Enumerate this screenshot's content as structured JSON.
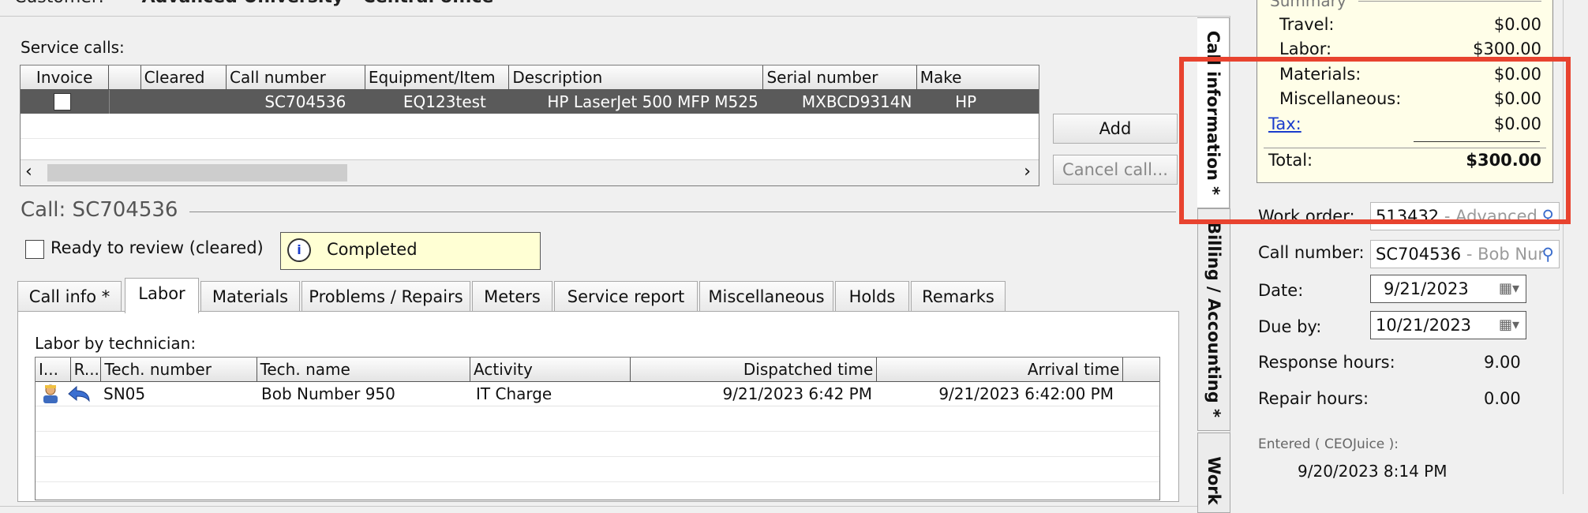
{
  "header": {
    "customer_label": "Customer:",
    "customer_value": "Advanced University - Central office"
  },
  "service_calls": {
    "label": "Service calls:",
    "columns": [
      "Invoice",
      "",
      "Cleared",
      "Call number",
      "Equipment/Item",
      "Description",
      "Serial number",
      "Make"
    ],
    "rows": [
      {
        "call_number": "SC704536",
        "equipment": "EQ123test",
        "description": "HP LaserJet 500 MFP M525",
        "serial": "MXBCD9314N",
        "make": "HP"
      }
    ],
    "add_button": "Add",
    "cancel_button": "Cancel call..."
  },
  "call": {
    "title": "Call: SC704536",
    "ready_label": "Ready to review (cleared)",
    "status": "Completed"
  },
  "tabs": [
    "Call info *",
    "Labor",
    "Materials",
    "Problems / Repairs",
    "Meters",
    "Service report",
    "Miscellaneous",
    "Holds",
    "Remarks"
  ],
  "labor": {
    "label": "Labor by technician:",
    "columns": [
      "I...",
      "R...",
      "Tech. number",
      "Tech. name",
      "Activity",
      "Dispatched time",
      "Arrival time"
    ],
    "rows": [
      {
        "tech_number": "SN05",
        "tech_name": "Bob Number 950",
        "activity": "IT Charge",
        "dispatched": "9/21/2023 6:42 PM",
        "arrival": "9/21/2023 6:42:00 PM"
      }
    ]
  },
  "side_tabs": [
    "Call information  *",
    "Billing / Accounting  *",
    "Work"
  ],
  "summary": {
    "title": "Summary",
    "travel_label": "Travel:",
    "travel_value": "$0.00",
    "labor_label": "Labor:",
    "labor_value": "$300.00",
    "materials_label": "Materials:",
    "materials_value": "$0.00",
    "misc_label": "Miscellaneous:",
    "misc_value": "$0.00",
    "tax_label": "Tax:",
    "tax_value": "$0.00",
    "total_label": "Total:",
    "total_value": "$300.00"
  },
  "details": {
    "work_order_label": "Work order:",
    "work_order_value": "513432",
    "work_order_suffix": " - Advanced",
    "call_number_label": "Call number:",
    "call_number_value": "SC704536",
    "call_number_suffix": " - Bob Nur",
    "date_label": "Date:",
    "date_value": "9/21/2023",
    "due_label": "Due by:",
    "due_value": "10/21/2023",
    "response_label": "Response hours:",
    "response_value": "9.00",
    "repair_label": "Repair hours:",
    "repair_value": "0.00",
    "entered_label": "Entered ( CEOJuice ):",
    "entered_value": "9/20/2023 8:14 PM"
  },
  "colors": {
    "selection_row": "#5a5a5a",
    "status_bg": "#ffffd4",
    "summary_bg": "#fffee8",
    "highlight": "#e8432f",
    "link": "#1a3ccc"
  }
}
